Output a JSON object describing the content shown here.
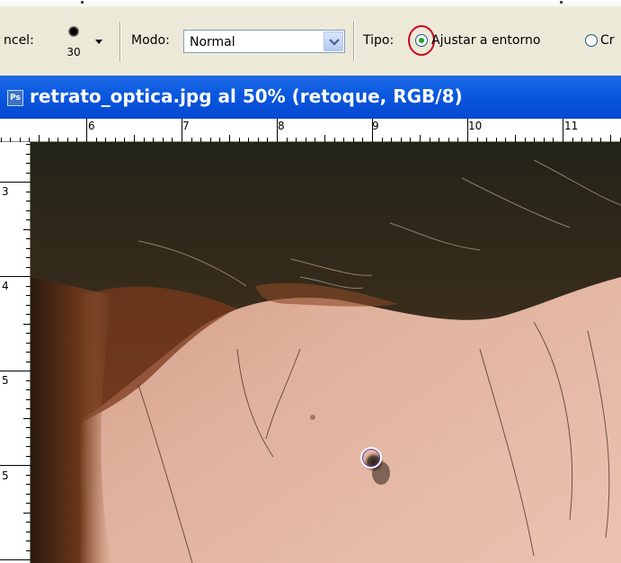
{
  "options_bar": {
    "brush_label": "ncel:",
    "brush_size": "30",
    "mode_label": "Modo:",
    "mode_value": "Normal",
    "type_label": "Tipo:",
    "option_adjust": "Ajustar a entorno",
    "option_create": "Cr"
  },
  "document": {
    "title": "retrato_optica.jpg al 50% (retoque, RGB/8)",
    "icon_text": "Ps"
  },
  "ruler_h": {
    "labels": [
      "6",
      "7",
      "8",
      "9",
      "10",
      "11"
    ]
  },
  "ruler_v": {
    "labels": [
      "3",
      "4",
      "5",
      "5"
    ]
  },
  "colors": {
    "title_bar": "#0a58df",
    "toolbar": "#ece9d8",
    "highlight_ring": "#d0001a",
    "radio_dot": "#21a121"
  }
}
